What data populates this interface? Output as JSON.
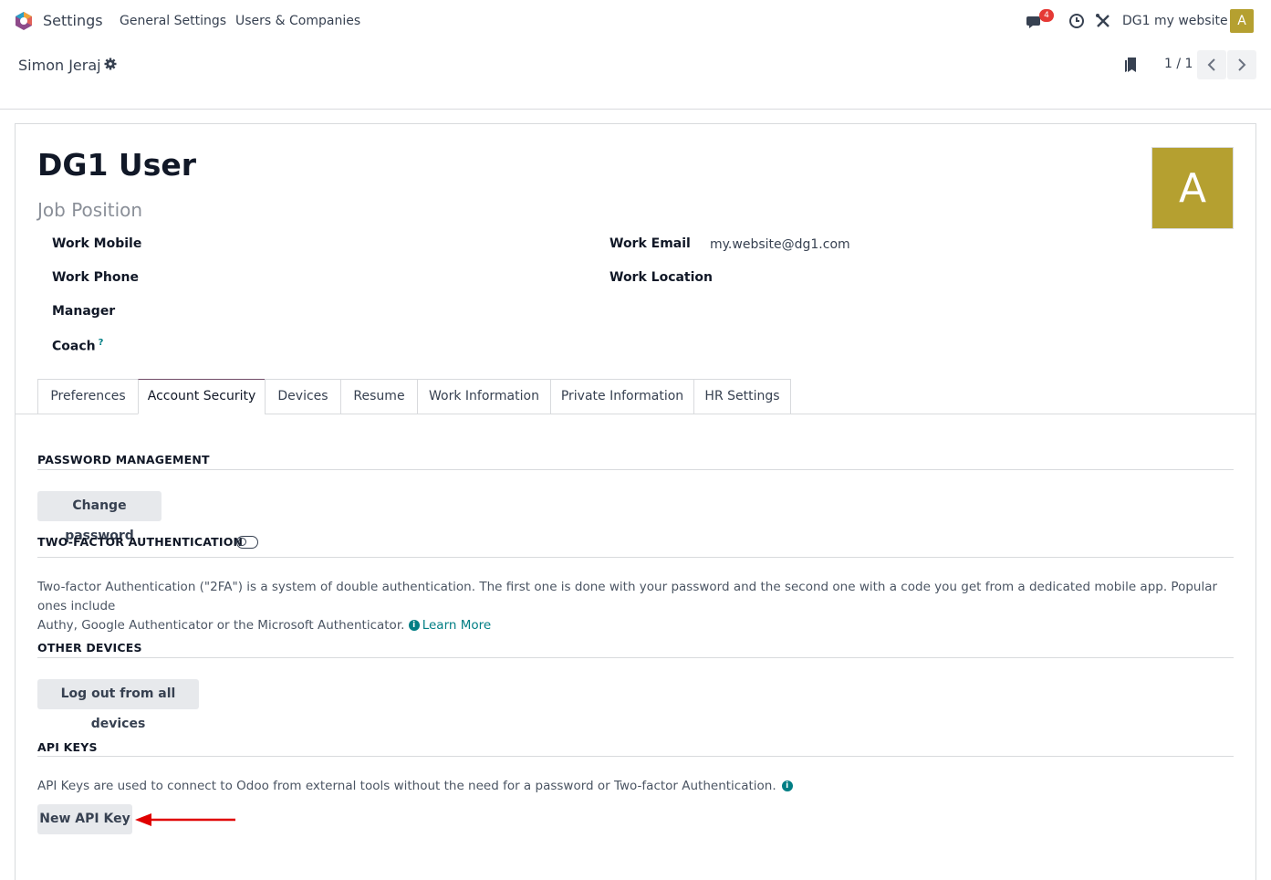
{
  "navbar": {
    "app_name": "Settings",
    "menus": [
      "General Settings",
      "Users & Companies"
    ],
    "message_count": "4",
    "company": "DG1 my website",
    "avatar_letter": "A"
  },
  "control": {
    "breadcrumb": "Simon Jeraj",
    "pager": "1 / 1"
  },
  "employee": {
    "name": "DG1 User",
    "job_position_placeholder": "Job Position",
    "avatar_letter": "A",
    "fields_left": [
      {
        "label": "Work Mobile",
        "value": ""
      },
      {
        "label": "Work Phone",
        "value": ""
      },
      {
        "label": "Manager",
        "value": ""
      },
      {
        "label": "Coach",
        "value": "",
        "help": "?"
      }
    ],
    "fields_right": [
      {
        "label": "Work Email",
        "value": "my.website@dg1.com"
      },
      {
        "label": "Work Location",
        "value": ""
      }
    ]
  },
  "tabs": [
    "Preferences",
    "Account Security",
    "Devices",
    "Resume",
    "Work Information",
    "Private Information",
    "HR Settings"
  ],
  "active_tab": "Account Security",
  "security": {
    "password_title": "PASSWORD MANAGEMENT",
    "change_password": "Change password",
    "twofa_title": "TWO-FACTOR AUTHENTICATION",
    "twofa_enabled": false,
    "twofa_desc_1": "Two-factor Authentication (\"2FA\") is a system of double authentication. The first one is done with your password and the second one with a code you get from a dedicated mobile app. Popular ones include",
    "twofa_desc_2": "Authy, Google Authenticator or the Microsoft Authenticator.",
    "learn_more": "Learn More",
    "devices_title": "OTHER DEVICES",
    "logout_all": "Log out from all devices",
    "api_title": "API KEYS",
    "api_desc": "API Keys are used to connect to Odoo from external tools without the need for a password or Two-factor Authentication.",
    "new_api_key": "New API Key"
  },
  "colors": {
    "brand": "#714b67",
    "accent": "#017e84",
    "avatar": "#b5a030",
    "badge": "#e53935",
    "annotation_arrow": "#e00000"
  }
}
